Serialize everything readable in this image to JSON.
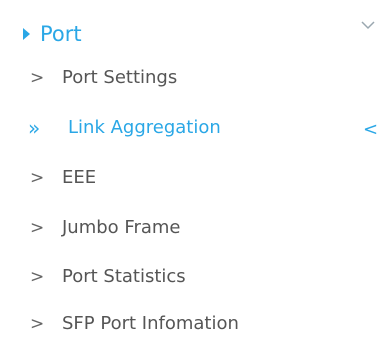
{
  "menu": {
    "header": {
      "label": "Port",
      "expand_icon": "triangle-right-icon",
      "collapse_icon": "chevron-down-icon"
    },
    "items": [
      {
        "chevron": ">",
        "label": "Port Settings",
        "active": false
      },
      {
        "chevron": "»",
        "label": "Link Aggregation",
        "active": true,
        "indicator": "<"
      },
      {
        "chevron": ">",
        "label": "EEE",
        "active": false
      },
      {
        "chevron": ">",
        "label": "Jumbo Frame",
        "active": false
      },
      {
        "chevron": ">",
        "label": "Port Statistics",
        "active": false
      },
      {
        "chevron": ">",
        "label": "SFP Port Infomation",
        "active": false
      }
    ],
    "colors": {
      "accent": "#2aa7e6",
      "text": "#555555",
      "background": "#ffffff"
    }
  }
}
